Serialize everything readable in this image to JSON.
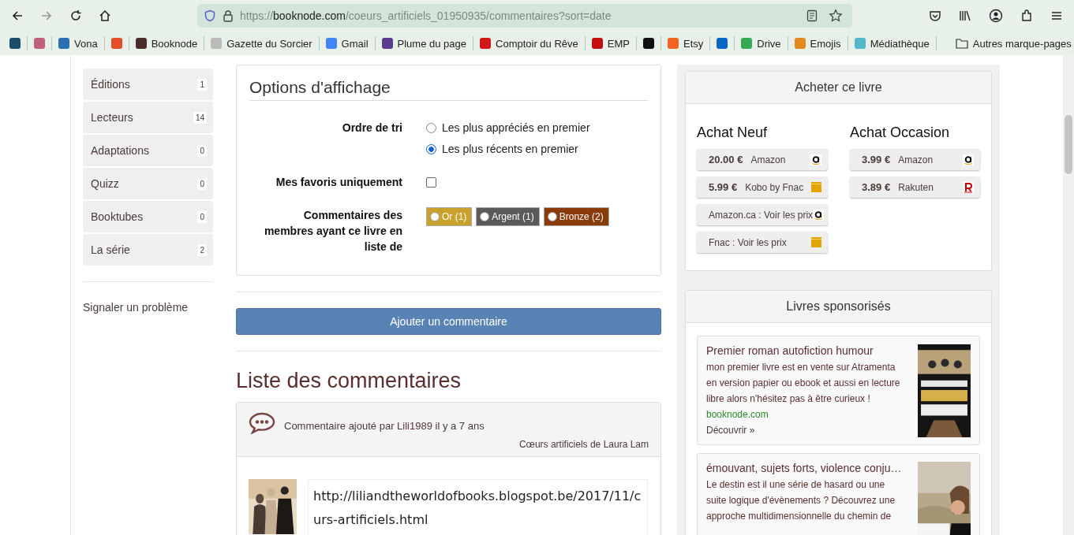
{
  "browser": {
    "url": {
      "scheme": "https://",
      "host": "booknode.com",
      "path": "/coeurs_artificiels_01950935/commentaires?sort=date"
    },
    "bookmarks": [
      {
        "kind": "icon"
      },
      {
        "kind": "icon"
      },
      {
        "kind": "link",
        "label": "Vona"
      },
      {
        "kind": "icon"
      },
      {
        "kind": "link",
        "label": "Booknode"
      },
      {
        "kind": "link",
        "label": "Gazette du Sorcier"
      },
      {
        "kind": "link",
        "label": "Gmail"
      },
      {
        "kind": "link",
        "label": "Plume du page"
      },
      {
        "kind": "link",
        "label": "Comptoir du Rêve"
      },
      {
        "kind": "link",
        "label": "EMP"
      },
      {
        "kind": "icon"
      },
      {
        "kind": "link",
        "label": "Etsy"
      },
      {
        "kind": "icon"
      },
      {
        "kind": "link",
        "label": "Drive"
      },
      {
        "kind": "link",
        "label": "Emojis"
      },
      {
        "kind": "link",
        "label": "Médiathèque"
      }
    ],
    "other_bookmarks": "Autres marque-pages"
  },
  "sidebar": {
    "items": [
      {
        "label": "Éditions",
        "count": "1"
      },
      {
        "label": "Lecteurs",
        "count": "14"
      },
      {
        "label": "Adaptations",
        "count": "0"
      },
      {
        "label": "Quizz",
        "count": "0"
      },
      {
        "label": "Booktubes",
        "count": "0"
      },
      {
        "label": "La série",
        "count": "2"
      }
    ],
    "report_link": "Signaler un problème"
  },
  "display_options": {
    "title": "Options d'affichage",
    "sort": {
      "label": "Ordre de tri",
      "options": [
        {
          "label": "Les plus appréciés en premier",
          "selected": false
        },
        {
          "label": "Les plus récents en premier",
          "selected": true
        }
      ]
    },
    "favorites": {
      "label": "Mes favoris uniquement",
      "checked": false
    },
    "lists": {
      "label": "Commentaires des membres ayant ce livre en liste de",
      "options": [
        {
          "label": "Or (1)",
          "selected": false,
          "color": "#c9a22e"
        },
        {
          "label": "Argent (1)",
          "selected": false,
          "color": "#5a5a5a"
        },
        {
          "label": "Bronze (2)",
          "selected": false,
          "color": "#8b3a0a"
        }
      ]
    }
  },
  "add_comment_button": "Ajouter un commentaire",
  "comments": {
    "title": "Liste des commentaires",
    "items": [
      {
        "prefix": "Commentaire ajouté par",
        "author": "Lili1989",
        "time": "il y a 7 ans",
        "book": "Cœurs artificiels de Laura Lam",
        "text": "http://liliandtheworldofbooks.blogspot.be/2017/11/curs-artificiels.html"
      }
    ]
  },
  "buy": {
    "title": "Acheter ce livre",
    "columns": [
      {
        "heading": "Achat Neuf",
        "offers": [
          {
            "price": "20.00 €",
            "store": "Amazon",
            "kind": "amazon"
          },
          {
            "price": "5.99 €",
            "store": "Kobo by Fnac",
            "kind": "fnac"
          },
          {
            "store": "Amazon.ca : Voir les prix",
            "kind": "amazon"
          },
          {
            "store": "Fnac : Voir les prix",
            "kind": "fnac"
          }
        ]
      },
      {
        "heading": "Achat Occasion",
        "offers": [
          {
            "price": "3.99 €",
            "store": "Amazon",
            "kind": "amazon"
          },
          {
            "price": "3.89 €",
            "store": "Rakuten",
            "kind": "rakuten"
          }
        ]
      }
    ]
  },
  "sponsored": {
    "title": "Livres sponsorisés",
    "items": [
      {
        "title": "Premier roman autofiction humour",
        "text": "mon premier livre est en vente sur Atramenta en version papier ou ebook et aussi en lecture libre alors n'hésitez pas à être curieux !",
        "site": "booknode.com",
        "link": "Découvrir »"
      },
      {
        "title": "émouvant, sujets forts, violence conju…",
        "text": "Le destin est il une série de hasard ou une suite logique d'évènements ? Découvrez une approche multidimensionnelle du chemin de"
      }
    ]
  }
}
